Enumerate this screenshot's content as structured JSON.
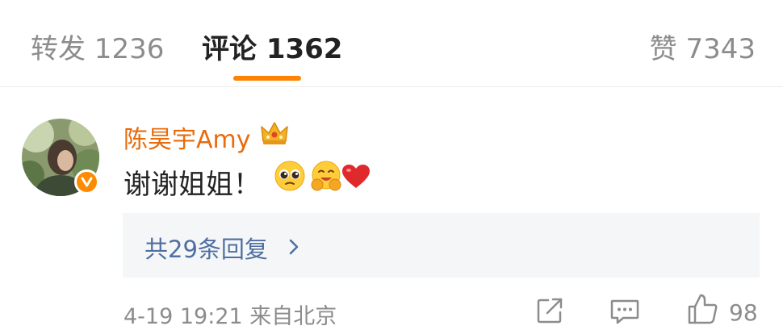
{
  "tabs": {
    "repost": "转发 1236",
    "comment": "评论 1362",
    "like": "赞 7343"
  },
  "active_tab": "comment",
  "colors": {
    "accent": "#ff8200",
    "username": "#e86b0c",
    "link": "#4e6fa0",
    "muted": "#8c8c8c"
  },
  "comment": {
    "author": "陈昊宇Amy",
    "author_badge_icon": "crown-icon",
    "avatar_badge_icon": "verified-v-icon",
    "text": "谢谢姐姐！",
    "emojis": [
      "pleading-face-emoji",
      "hugging-face-emoji",
      "red-heart-emoji"
    ],
    "replies_label": "共29条回复",
    "time_location": "4-19 19:21 来自北京",
    "action_icons": [
      "share-icon",
      "reply-icon",
      "like-icon"
    ],
    "like_count": "98"
  }
}
